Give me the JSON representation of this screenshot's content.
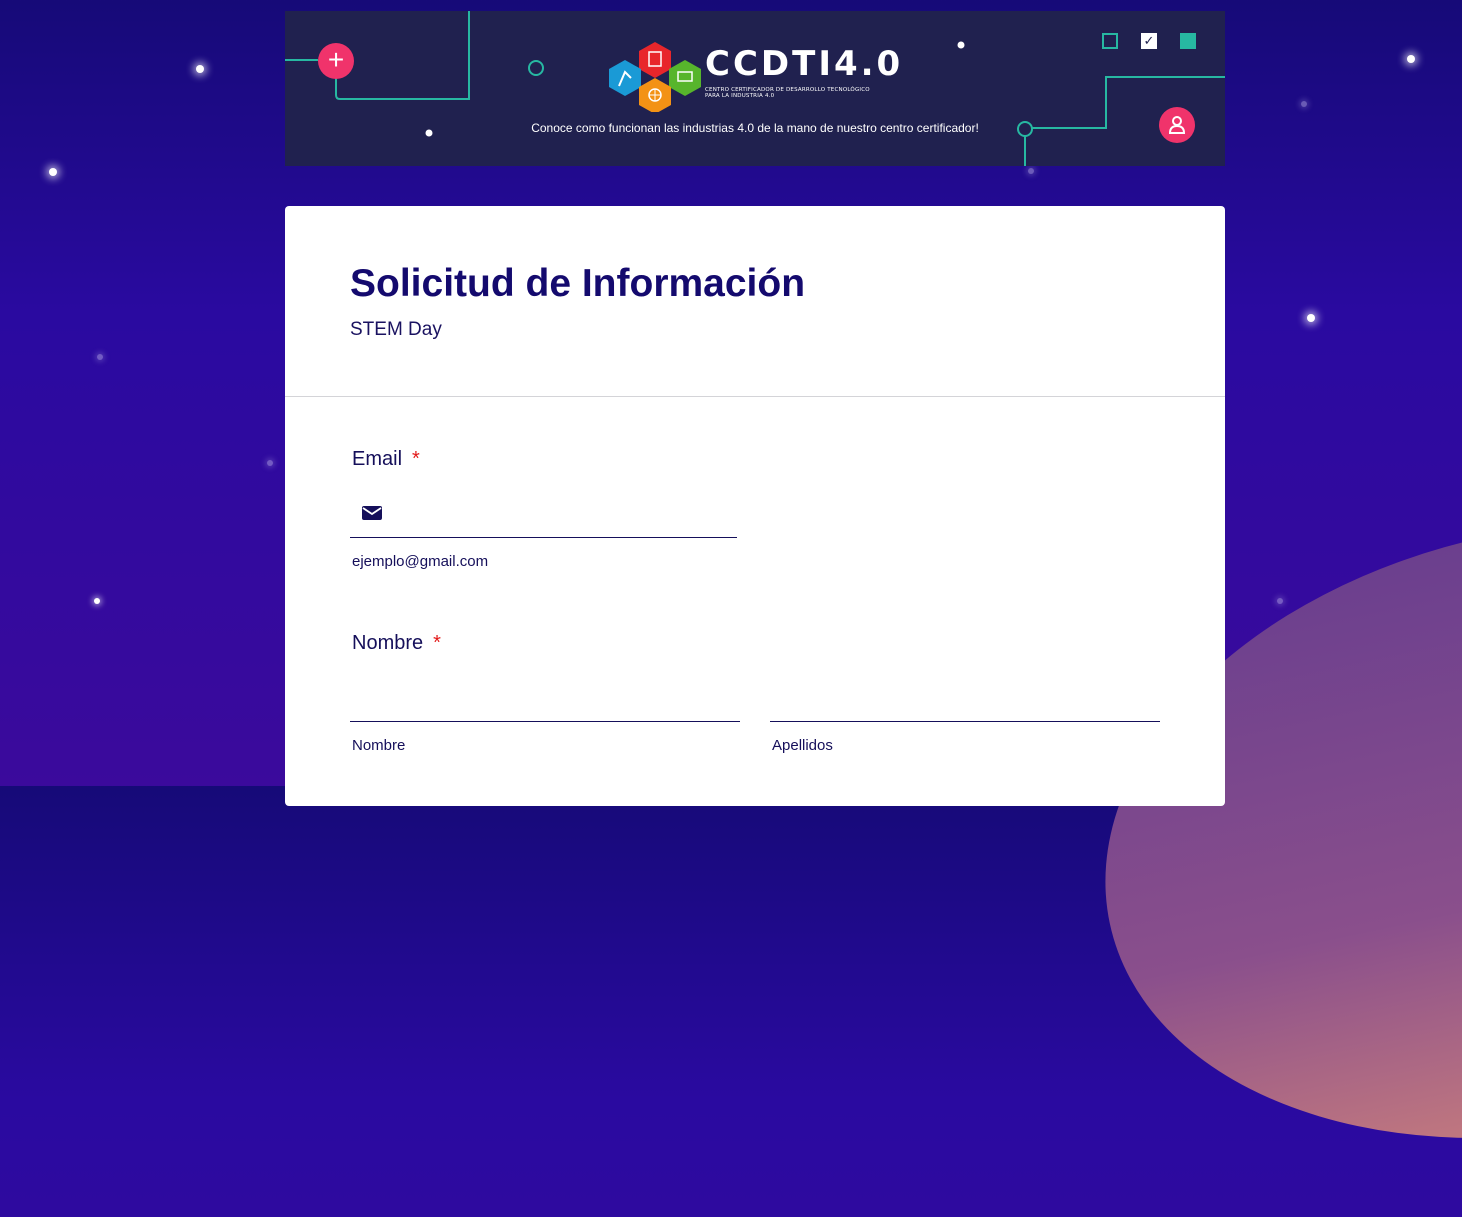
{
  "banner": {
    "brand_name": "CCDTI4.0",
    "brand_subtitle_line1": "CENTRO CERTIFICADOR DE DESARROLLO TECNOLÓGICO",
    "brand_subtitle_line2": "PARA LA INDUSTRIA 4.0",
    "tagline": "Conoce como funcionan las industrias 4.0 de la mano de nuestro centro certificador!",
    "plus_glyph": "+",
    "check_glyph": "✓",
    "colors": {
      "background": "#20214f",
      "accent_teal": "#27b8a2",
      "accent_pink": "#f0336b"
    }
  },
  "form": {
    "title": "Solicitud de Información",
    "subtitle": "STEM Day",
    "fields": {
      "email": {
        "label": "Email",
        "required_mark": "*",
        "value": "",
        "hint": "ejemplo@gmail.com",
        "icon": "envelope-icon"
      },
      "nombre": {
        "label": "Nombre",
        "required_mark": "*",
        "first_name": {
          "value": "",
          "hint": "Nombre"
        },
        "last_name": {
          "value": "",
          "hint": "Apellidos"
        }
      }
    }
  }
}
